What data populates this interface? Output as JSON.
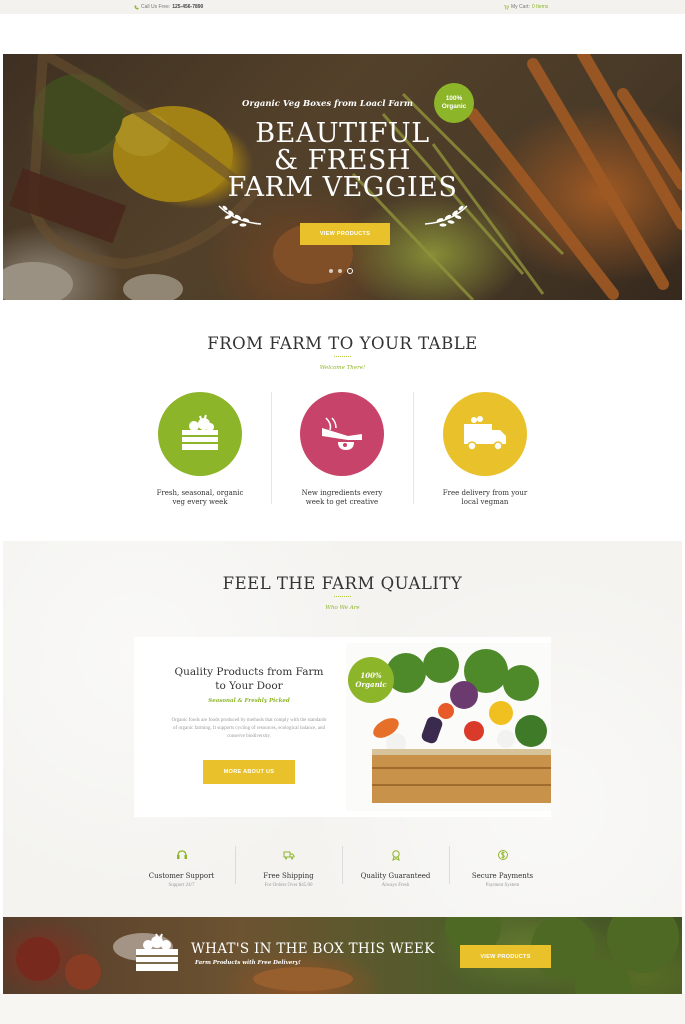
{
  "topbar": {
    "call_label": "Call Us Free:",
    "phone": "125-456-7890",
    "cart_label": "My Cart:",
    "cart_count": "0 Items"
  },
  "hero": {
    "kicker": "Organic Veg Boxes from Loacl Farm",
    "badge_line1": "100%",
    "badge_line2": "Organic",
    "title_line1": "BEAUTIFUL",
    "title_line2": "& FRESH",
    "title_line3": "FARM VEGGIES",
    "button": "VIEW PRODUCTS",
    "slides": 3,
    "active_slide": 3
  },
  "farm_section": {
    "title": "FROM FARM TO YOUR TABLE",
    "subtitle": "Welcome There!",
    "features": [
      {
        "line1": "Fresh, seasonal, organic",
        "line2": "veg every week",
        "color": "#8db52a",
        "icon": "vegetable-basket-icon"
      },
      {
        "line1": "New ingredients every",
        "line2": "week to get creative",
        "color": "#c8436a",
        "icon": "oil-bottle-icon"
      },
      {
        "line1": "Free delivery from your",
        "line2": "local vegman",
        "color": "#e9c22b",
        "icon": "delivery-truck-icon"
      }
    ]
  },
  "quality_section": {
    "title": "FEEL THE FARM QUALITY",
    "subtitle": "Who We Are",
    "card": {
      "title_line1": "Quality Products from Farm",
      "title_line2": "to Your Door",
      "subtitle": "Seasonal & Freshly Picked",
      "body": "Organic foods are foods produced by methods that comply with the standards of organic farming. It supports cycling of resources, ecological balance, and conserve biodiversity.",
      "button": "MORE ABOUT US",
      "badge_line1": "100%",
      "badge_line2": "Organic"
    },
    "services": [
      {
        "title": "Customer Support",
        "sub": "Support 24/7",
        "icon": "headset-icon"
      },
      {
        "title": "Free Shipping",
        "sub": "For Orders Over $45.00",
        "icon": "truck-icon"
      },
      {
        "title": "Quality Guaranteed",
        "sub": "Always Fresh",
        "icon": "medal-icon"
      },
      {
        "title": "Secure Payments",
        "sub": "Payment System",
        "icon": "dollar-circle-icon"
      }
    ]
  },
  "banner": {
    "title": "WHAT'S IN THE BOX THIS WEEK",
    "subtitle": "Farm Products with Free Delivery!",
    "button": "VIEW PRODUCTS"
  },
  "colors": {
    "accent_green": "#8db52a",
    "accent_yellow": "#e9c22b",
    "accent_pink": "#c8436a"
  }
}
